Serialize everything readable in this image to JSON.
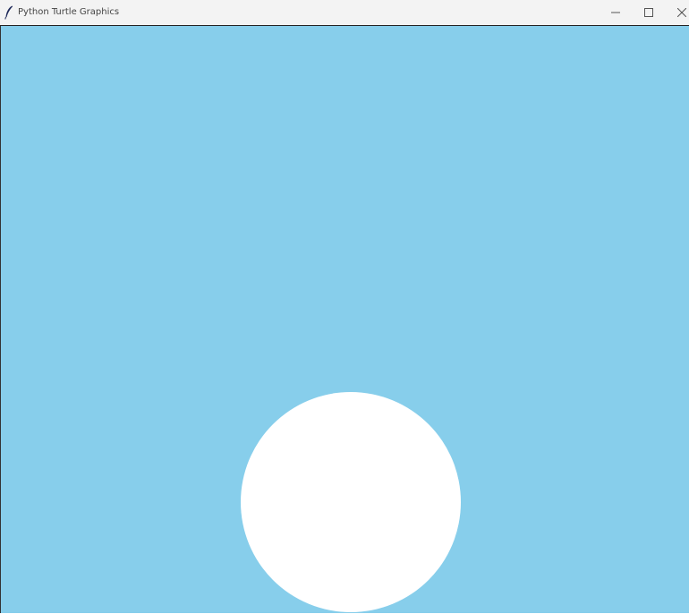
{
  "window": {
    "title": "Python Turtle Graphics",
    "icon": "feather-icon",
    "controls": {
      "minimize": "minimize-icon",
      "maximize": "maximize-icon",
      "close": "close-icon"
    }
  },
  "canvas": {
    "background_color": "#87ceeb",
    "shapes": [
      {
        "type": "circle",
        "fill_color": "#ffffff"
      }
    ]
  }
}
